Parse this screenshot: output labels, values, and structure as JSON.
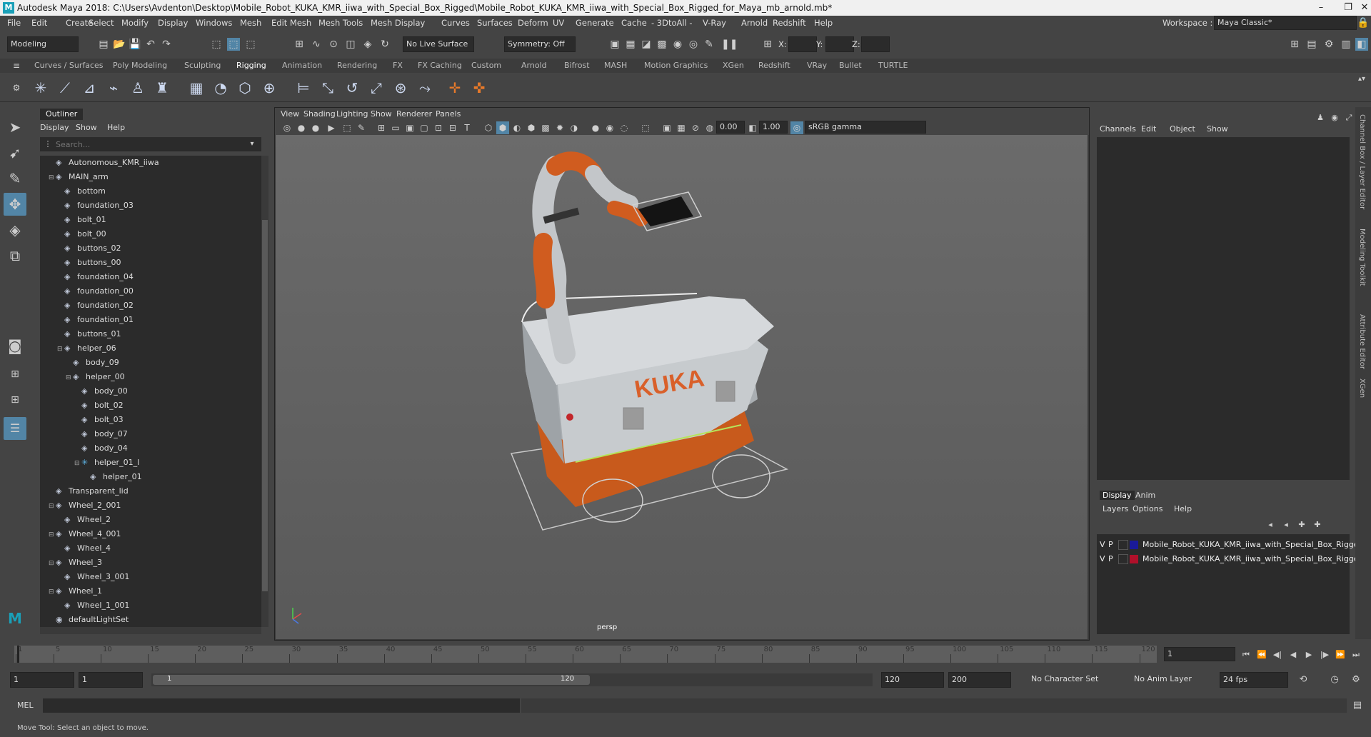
{
  "window": {
    "title": "Autodesk Maya 2018: C:\\Users\\Avdenton\\Desktop\\Mobile_Robot_KUKA_KMR_iiwa_with_Special_Box_Rigged\\Mobile_Robot_KUKA_KMR_iiwa_with_Special_Box_Rigged_for_Maya_mb_arnold.mb*",
    "logo": "M"
  },
  "menus": [
    "File",
    "Edit",
    "Create",
    "Select",
    "Modify",
    "Display",
    "Windows",
    "Mesh",
    "Edit Mesh",
    "Mesh Tools",
    "Mesh Display",
    "Curves",
    "Surfaces",
    "Deform",
    "UV",
    "Generate",
    "Cache",
    "- 3DtoAll -",
    "V-Ray",
    "Arnold",
    "Redshift",
    "Help"
  ],
  "workspace": {
    "label": "Workspace :",
    "value": "Maya Classic*"
  },
  "status": {
    "mode": "Modeling",
    "live_surface": "No Live Surface",
    "symmetry": "Symmetry: Off",
    "x_label": "X:",
    "y_label": "Y:",
    "z_label": "Z:"
  },
  "shelf_tabs": [
    "Curves / Surfaces",
    "Poly Modeling",
    "Sculpting",
    "Rigging",
    "Animation",
    "Rendering",
    "FX",
    "FX Caching",
    "Custom",
    "Arnold",
    "Bifrost",
    "MASH",
    "Motion Graphics",
    "XGen",
    "Redshift",
    "VRay",
    "Bullet",
    "TURTLE"
  ],
  "shelf_active": "Rigging",
  "outliner": {
    "tab": "Outliner",
    "menus": [
      "Display",
      "Show",
      "Help"
    ],
    "search_placeholder": "Search...",
    "items": [
      {
        "label": "Autonomous_KMR_iiwa",
        "depth": 0,
        "expand": "+"
      },
      {
        "label": "MAIN_arm",
        "depth": 0,
        "expand": "-"
      },
      {
        "label": "bottom",
        "depth": 1,
        "expand": "+"
      },
      {
        "label": "foundation_03",
        "depth": 1,
        "expand": "+"
      },
      {
        "label": "bolt_01",
        "depth": 1,
        "expand": "+"
      },
      {
        "label": "bolt_00",
        "depth": 1,
        "expand": "+"
      },
      {
        "label": "buttons_02",
        "depth": 1,
        "expand": "+"
      },
      {
        "label": "buttons_00",
        "depth": 1,
        "expand": "+"
      },
      {
        "label": "foundation_04",
        "depth": 1,
        "expand": "+"
      },
      {
        "label": "foundation_00",
        "depth": 1,
        "expand": "+"
      },
      {
        "label": "foundation_02",
        "depth": 1,
        "expand": "+"
      },
      {
        "label": "foundation_01",
        "depth": 1,
        "expand": "+"
      },
      {
        "label": "buttons_01",
        "depth": 1,
        "expand": "+"
      },
      {
        "label": "helper_06",
        "depth": 1,
        "expand": "-"
      },
      {
        "label": "body_09",
        "depth": 2,
        "expand": "+"
      },
      {
        "label": "helper_00",
        "depth": 2,
        "expand": "-"
      },
      {
        "label": "body_00",
        "depth": 3,
        "expand": "+"
      },
      {
        "label": "bolt_02",
        "depth": 3,
        "expand": "+"
      },
      {
        "label": "bolt_03",
        "depth": 3,
        "expand": "+"
      },
      {
        "label": "body_07",
        "depth": 3,
        "expand": "+"
      },
      {
        "label": "body_04",
        "depth": 3,
        "expand": "+"
      },
      {
        "label": "helper_01_l",
        "depth": 3,
        "expand": "-"
      },
      {
        "label": "helper_01",
        "depth": 4,
        "expand": "+"
      },
      {
        "label": "Transparent_lid",
        "depth": 0,
        "expand": "+"
      },
      {
        "label": "Wheel_2_001",
        "depth": 0,
        "expand": "-"
      },
      {
        "label": "Wheel_2",
        "depth": 1,
        "expand": "+"
      },
      {
        "label": "Wheel_4_001",
        "depth": 0,
        "expand": "-"
      },
      {
        "label": "Wheel_4",
        "depth": 1,
        "expand": "+"
      },
      {
        "label": "Wheel_3",
        "depth": 0,
        "expand": "-"
      },
      {
        "label": "Wheel_3_001",
        "depth": 1,
        "expand": "+"
      },
      {
        "label": "Wheel_1",
        "depth": 0,
        "expand": "-"
      },
      {
        "label": "Wheel_1_001",
        "depth": 1,
        "expand": "+"
      },
      {
        "label": "defaultLightSet",
        "depth": 0,
        "expand": ""
      }
    ]
  },
  "viewport": {
    "menus": [
      "View",
      "Shading",
      "Lighting",
      "Show",
      "Renderer",
      "Panels"
    ],
    "exposure": "0.00",
    "gamma": "1.00",
    "color_space": "sRGB gamma",
    "camera": "persp",
    "decal_text": "KUKA"
  },
  "channel_box": {
    "menus": [
      "Channels",
      "Edit",
      "Object",
      "Show"
    ]
  },
  "layer_editor": {
    "tabs": [
      "Display",
      "Anim"
    ],
    "menus": [
      "Layers",
      "Options",
      "Help"
    ],
    "layers": [
      {
        "v": "V",
        "p": "P",
        "color": "#1a1a9a",
        "name": "Mobile_Robot_KUKA_KMR_iiwa_with_Special_Box_Rigged"
      },
      {
        "v": "V",
        "p": "P",
        "color": "#b0102a",
        "name": "Mobile_Robot_KUKA_KMR_iiwa_with_Special_Box_Rigged"
      }
    ]
  },
  "side_tabs": [
    "Channel Box / Layer Editor",
    "Modeling Toolkit",
    "Attribute Editor",
    "XGen"
  ],
  "timeline": {
    "ticks": [
      "1",
      "5",
      "10",
      "15",
      "20",
      "25",
      "30",
      "35",
      "40",
      "45",
      "50",
      "55",
      "60",
      "65",
      "70",
      "75",
      "80",
      "85",
      "90",
      "95",
      "100",
      "105",
      "110",
      "115",
      "120"
    ],
    "current_frame": "1"
  },
  "range": {
    "start": "1",
    "playback_start": "1",
    "slider_start": "1",
    "slider_end": "120",
    "playback_end": "120",
    "end": "200",
    "character_set": "No Character Set",
    "anim_layer": "No Anim Layer",
    "fps": "24 fps"
  },
  "mel": {
    "label": "MEL"
  },
  "help_line": "Move Tool: Select an object to move."
}
